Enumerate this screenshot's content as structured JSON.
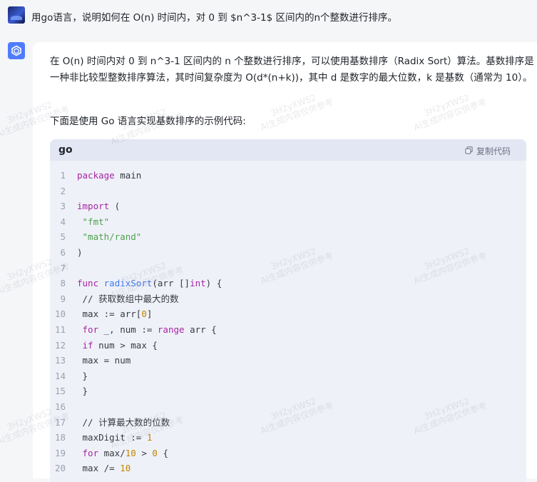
{
  "user_message": {
    "text": "用go语言，说明如何在 O(n) 时间内，对 0 到 $n^3-1$ 区间内的n个整数进行排序。"
  },
  "answer": {
    "paragraph_1": "在 O(n) 时间内对 0 到 n^3-1 区间内的 n 个整数进行排序，可以使用基数排序（Radix Sort）算法。基数排序是一种非比较型整数排序算法，其时间复杂度为 O(d*(n+k))，其中 d 是数字的最大位数，k 是基数（通常为 10）。",
    "paragraph_2": "下面是使用 Go 语言实现基数排序的示例代码:",
    "code": {
      "language": "go",
      "copy_label": "复制代码",
      "line_numbers": [
        "1",
        "2",
        "3",
        "4",
        "5",
        "6",
        "7",
        "8",
        "9",
        "10",
        "11",
        "12",
        "13",
        "14",
        "15",
        "16",
        "17",
        "18",
        "19",
        "20"
      ],
      "lines": [
        "package main",
        "",
        "import (",
        " \"fmt\"",
        " \"math/rand\"",
        ")",
        "",
        "func radixSort(arr []int) {",
        " // 获取数组中最大的数",
        " max := arr[0]",
        " for _, num := range arr {",
        " if num > max {",
        " max = num",
        " }",
        " }",
        "",
        " // 计算最大数的位数",
        " maxDigit := 1",
        " for max/10 > 0 {",
        " max /= 10"
      ]
    }
  },
  "watermark": {
    "line1": "3H2yXWS2",
    "line2": "AI生成内容仅供参考"
  },
  "colors": {
    "accent": "#4f7cff",
    "code_bg": "#eff1f8",
    "code_header_bg": "#e3e7f3",
    "keyword": "#a626a4",
    "string": "#50a14f",
    "function": "#4078f2",
    "number": "#c18401"
  }
}
